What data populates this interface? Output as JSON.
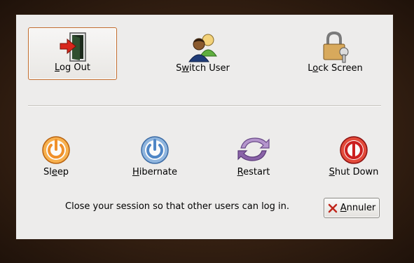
{
  "dialog": {
    "actions_top": [
      {
        "label_pre": "",
        "label_u": "L",
        "label_post": "og Out",
        "icon": "logout-door-icon"
      },
      {
        "label_pre": "S",
        "label_u": "w",
        "label_post": "itch User",
        "icon": "switch-user-icon"
      },
      {
        "label_pre": "L",
        "label_u": "o",
        "label_post": "ck Screen",
        "icon": "lock-screen-icon"
      }
    ],
    "actions_bottom": [
      {
        "label_pre": "Sl",
        "label_u": "e",
        "label_post": "ep",
        "icon": "sleep-power-icon",
        "color": "#f0902a"
      },
      {
        "label_pre": "",
        "label_u": "H",
        "label_post": "ibernate",
        "icon": "hibernate-power-icon",
        "color": "#4f86c6"
      },
      {
        "label_pre": "",
        "label_u": "R",
        "label_post": "estart",
        "icon": "restart-icon",
        "color": "#8a63a8"
      },
      {
        "label_pre": "",
        "label_u": "S",
        "label_post": "hut Down",
        "icon": "shutdown-icon",
        "color": "#cc1f1f"
      }
    ],
    "message": "Close your session so that other users can log in.",
    "cancel": {
      "label_u": "A",
      "label_post": "nnuler",
      "icon": "cancel-x-icon"
    }
  }
}
